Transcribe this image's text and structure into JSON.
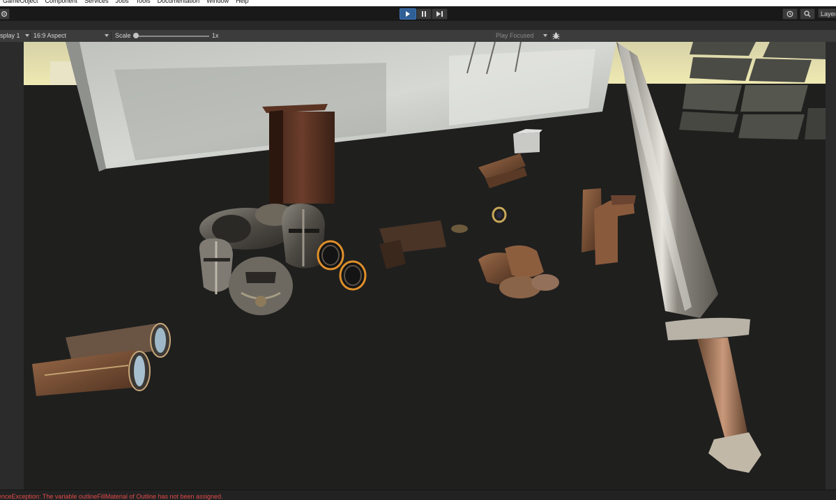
{
  "menu": {
    "items": [
      {
        "label": "GameObject"
      },
      {
        "label": "Component"
      },
      {
        "label": "Services"
      },
      {
        "label": "Jobs"
      },
      {
        "label": "Tools"
      },
      {
        "label": "Documentation"
      },
      {
        "label": "Window"
      },
      {
        "label": "Help"
      }
    ]
  },
  "toolbar": {
    "play_icon": "play-icon",
    "pause_icon": "pause-icon",
    "step_icon": "step-icon",
    "history_icon": "history-icon",
    "search_icon": "search-icon",
    "layers_label": "Layers",
    "play_active_color": "#2f5f95"
  },
  "gamebar": {
    "display": "splay 1",
    "aspect": "16:9 Aspect",
    "scale_label": "Scale",
    "scale_value": "1x",
    "play_mode": "Play Focused",
    "bug_icon": "bug-icon",
    "scale_level": 0.0
  },
  "status": {
    "message": "renceException: The variable outlineFillMaterial of Outline has not been assigned.",
    "color": "#e24a4a"
  },
  "scene": {
    "objects": [
      "wall-panel",
      "wooden-cabinet",
      "hanging-swords",
      "helmet",
      "bracers",
      "gauntlets",
      "boots",
      "ring",
      "sword",
      "cube",
      "stone-blocks"
    ],
    "highlight_color": "#e0902a"
  }
}
